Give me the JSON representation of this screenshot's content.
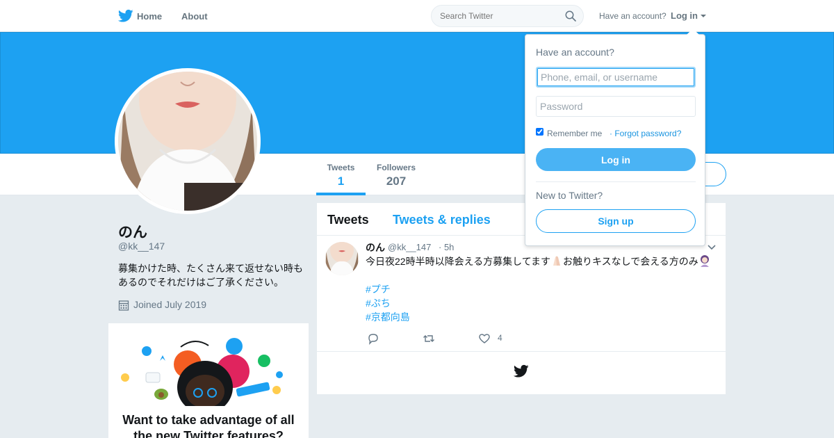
{
  "nav": {
    "home_label": "Home",
    "about_label": "About",
    "search_placeholder": "Search Twitter",
    "have_account": "Have an account?",
    "login_label": "Log in"
  },
  "profile": {
    "name": "のん",
    "handle": "@kk__147",
    "bio": "募集かけた時、たくさん来て返せない時もあるのでそれだけはご了承ください。",
    "joined": "Joined July 2019",
    "stats": [
      {
        "label": "Tweets",
        "value": "1"
      },
      {
        "label": "Followers",
        "value": "207"
      }
    ]
  },
  "timeline": {
    "tabs": [
      "Tweets",
      "Tweets & replies"
    ],
    "tweet": {
      "name": "のん",
      "handle": "@kk__147",
      "time": "· 5h",
      "text_part1": "今日夜22時半時以降会える方募集してます",
      "text_part2": "お触りキスなしで会える方のみ",
      "hashtags": [
        "#プチ",
        "#ぷち",
        "#京都向島"
      ],
      "like_count": "4"
    }
  },
  "promo": {
    "title": "Want to take advantage of all the new Twitter features?"
  },
  "login_dropdown": {
    "title": "Have an account?",
    "username_placeholder": "Phone, email, or username",
    "password_placeholder": "Password",
    "remember_label": "Remember me",
    "forgot_label": "· Forgot password?",
    "login_button": "Log in",
    "new_label": "New to Twitter?",
    "signup_button": "Sign up"
  },
  "colors": {
    "brand": "#1da1f2",
    "background": "#e6ecf0"
  },
  "icons": [
    "twitter-bird-icon",
    "search-icon",
    "caret-down-icon",
    "calendar-icon",
    "reply-icon",
    "retweet-icon",
    "heart-icon",
    "chevron-down-icon"
  ]
}
